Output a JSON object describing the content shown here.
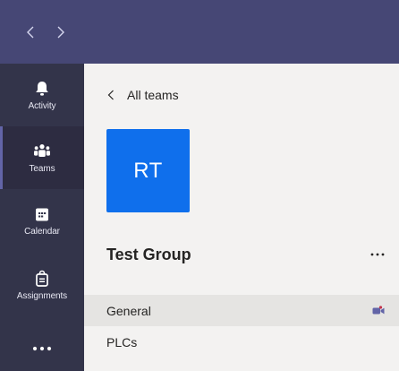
{
  "titlebar": {
    "back_icon": "chevron-left-icon",
    "forward_icon": "chevron-right-icon"
  },
  "rail": {
    "items": [
      {
        "label": "Activity",
        "icon": "bell-icon",
        "active": false
      },
      {
        "label": "Teams",
        "icon": "teams-icon",
        "active": true
      },
      {
        "label": "Calendar",
        "icon": "calendar-icon",
        "active": false
      },
      {
        "label": "Assignments",
        "icon": "assignments-icon",
        "active": false
      }
    ],
    "more_icon": "more-horizontal-icon"
  },
  "panel": {
    "back_label": "All teams",
    "team": {
      "initials": "RT",
      "name": "Test Group",
      "avatar_color": "#0f6fec"
    },
    "channels": [
      {
        "name": "General",
        "selected": true,
        "meeting_icon": "video-camera-icon"
      },
      {
        "name": "PLCs",
        "selected": false
      }
    ]
  },
  "colors": {
    "titlebar": "#464775",
    "rail": "#33344a",
    "accent": "#6264a7"
  }
}
